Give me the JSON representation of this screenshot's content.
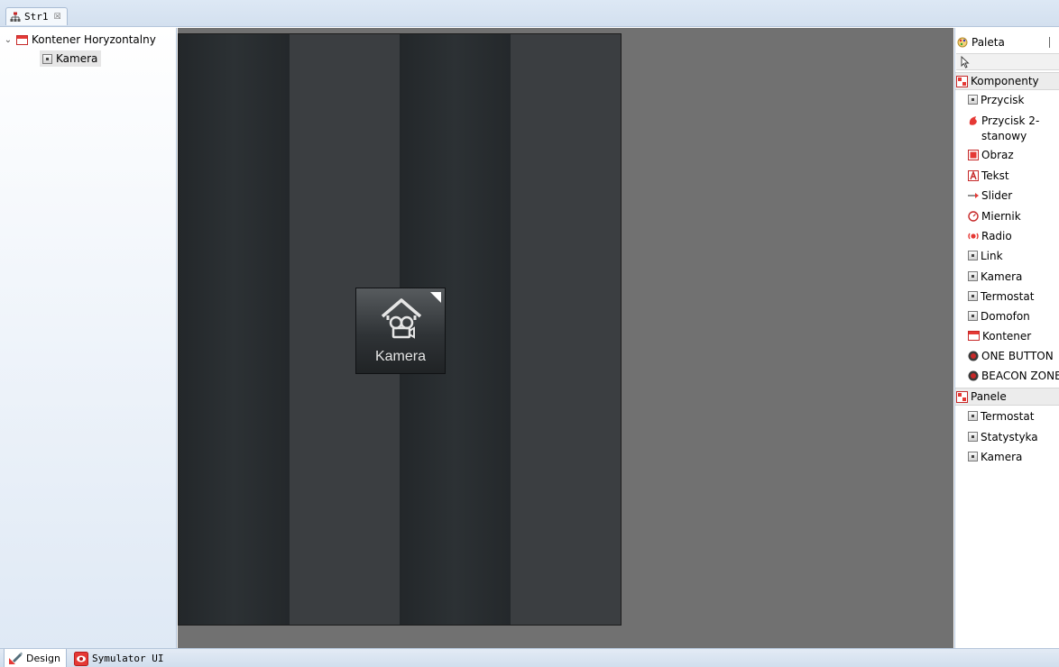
{
  "editor_tab": {
    "label": "Str1",
    "close": "☒"
  },
  "tree": {
    "root_label": "Kontener Horyzontalny",
    "child_label": "Kamera"
  },
  "canvas": {
    "widget_label": "Kamera",
    "stripe_colors": [
      "#2a2e31",
      "#3b3e41"
    ],
    "background": "#717171"
  },
  "palette": {
    "title": "Paleta",
    "groups": [
      {
        "label": "Komponenty",
        "items": [
          {
            "label": "Przycisk",
            "icon": "generic-component-icon"
          },
          {
            "label": "Przycisk 2-stanowy",
            "icon": "toggle-button-icon"
          },
          {
            "label": "Obraz",
            "icon": "image-icon"
          },
          {
            "label": "Tekst",
            "icon": "text-icon"
          },
          {
            "label": "Slider",
            "icon": "slider-icon"
          },
          {
            "label": "Miernik",
            "icon": "gauge-icon"
          },
          {
            "label": "Radio",
            "icon": "radio-icon"
          },
          {
            "label": "Link",
            "icon": "generic-component-icon"
          },
          {
            "label": "Kamera",
            "icon": "generic-component-icon"
          },
          {
            "label": "Termostat",
            "icon": "generic-component-icon"
          },
          {
            "label": "Domofon",
            "icon": "generic-component-icon"
          },
          {
            "label": "Kontener",
            "icon": "container-icon"
          },
          {
            "label": "ONE BUTTON",
            "icon": "round-button-icon"
          },
          {
            "label": "BEACON ZONE",
            "icon": "round-button-icon"
          }
        ]
      },
      {
        "label": "Panele",
        "items": [
          {
            "label": "Termostat",
            "icon": "generic-component-icon"
          },
          {
            "label": "Statystyka",
            "icon": "generic-component-icon"
          },
          {
            "label": "Kamera",
            "icon": "generic-component-icon"
          }
        ]
      }
    ]
  },
  "bottom_tabs": {
    "design": "Design",
    "simulator": "Symulator UI"
  }
}
